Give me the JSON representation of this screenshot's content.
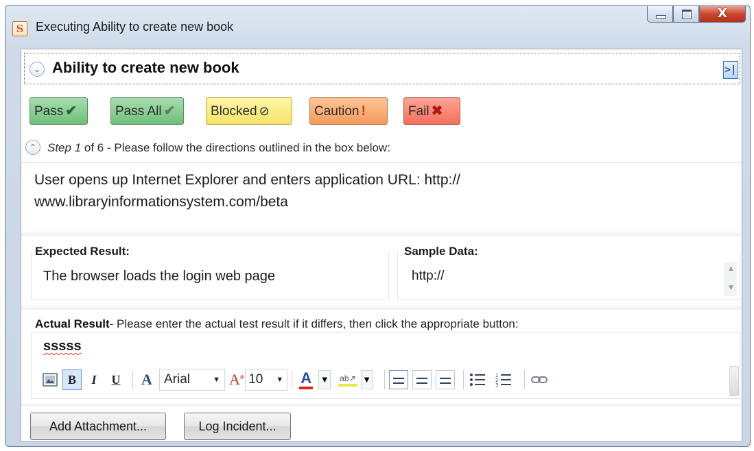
{
  "window": {
    "app_icon_letter": "S",
    "title": "Executing Ability to create new book",
    "close_glyph": "X"
  },
  "section": {
    "title": "Ability to create new book",
    "nav_end_glyph": ">|"
  },
  "status_buttons": {
    "pass": "Pass",
    "pass_all": "Pass All",
    "blocked": "Blocked",
    "caution": "Caution",
    "fail": "Fail"
  },
  "step": {
    "label": "Step 1",
    "of_text": "of 6 - Please follow the directions outlined in the box below:",
    "description": "User opens up Internet Explorer and enters application URL: http://\nwww.libraryinformationsystem.com/beta"
  },
  "expected_result": {
    "label": "Expected Result:",
    "value": "The browser loads the login web page"
  },
  "sample_data": {
    "label": "Sample Data:",
    "value": "http://"
  },
  "actual_result": {
    "label_bold": "Actual Result",
    "label_rest": "- Please enter the actual test result if it differs, then click the appropriate button:",
    "value": "sssss"
  },
  "editor_toolbar": {
    "bold": "B",
    "italic": "I",
    "underline": "U",
    "font_name": "Arial",
    "font_size": "10"
  },
  "commands": {
    "add_attachment": "Add Attachment...",
    "log_incident": "Log Incident..."
  },
  "colors": {
    "pass": "#6fc07b",
    "blocked": "#f4e36a",
    "caution": "#f39a5d",
    "fail": "#f26f5c",
    "font_color": "#d8261c",
    "highlight_color": "#e9e94a"
  },
  "icons": {
    "app": "app-logo-icon",
    "minimize": "minimize-icon",
    "maximize": "maximize-icon",
    "close": "close-icon",
    "collapse": "chevron-down-icon",
    "step_collapse": "chevron-up-icon",
    "nav_end": "go-to-end-icon",
    "pass": "check-icon",
    "pass_all": "double-check-icon",
    "blocked": "blocked-icon",
    "caution": "exclamation-icon",
    "fail": "cross-icon"
  }
}
